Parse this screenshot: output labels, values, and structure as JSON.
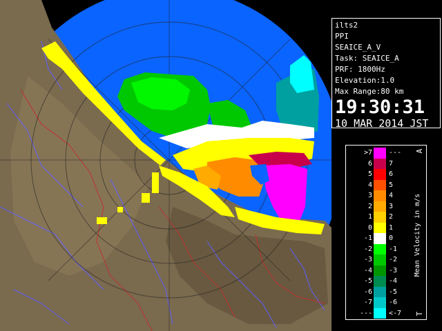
{
  "info": {
    "station": "ilts2",
    "mode": "PPI",
    "product": "SEAICE_A_V",
    "task": "Task: SEAICE_A",
    "prf": "PRF: 1800Hz",
    "elevation": "Elevation:1.0",
    "max_range": "Max Range:80 km",
    "time": "19:30:31",
    "date": "10 MAR 2014 JST"
  },
  "legend": {
    "title": "Mean Velocity in m/s",
    "top_letter": "A",
    "bottom_letter": "T",
    "rows": [
      {
        "left": ">7",
        "right": "---",
        "color": "#ff00ff"
      },
      {
        "left": "6",
        "right": "7",
        "color": "#c8004b"
      },
      {
        "left": "5",
        "right": "6",
        "color": "#ff0000"
      },
      {
        "left": "4",
        "right": "5",
        "color": "#ff5000"
      },
      {
        "left": "3",
        "right": "4",
        "color": "#ff8c00"
      },
      {
        "left": "2",
        "right": "3",
        "color": "#ffaa00"
      },
      {
        "left": "1",
        "right": "2",
        "color": "#ffd000"
      },
      {
        "left": "0",
        "right": "1",
        "color": "#ffff00"
      },
      {
        "left": "-1",
        "right": "0",
        "color": "#ffffff"
      },
      {
        "left": "-2",
        "right": "-1",
        "color": "#00ff00"
      },
      {
        "left": "-3",
        "right": "-2",
        "color": "#00c800"
      },
      {
        "left": "-4",
        "right": "-3",
        "color": "#009600"
      },
      {
        "left": "-5",
        "right": "-4",
        "color": "#008c50"
      },
      {
        "left": "-6",
        "right": "-5",
        "color": "#00a0a0"
      },
      {
        "left": "-7",
        "right": "-6",
        "color": "#00c8c8"
      },
      {
        "left": "---",
        "right": "<-7",
        "color": "#00ffff"
      }
    ]
  },
  "colors": {
    "sea": "#0a64ff",
    "land": "#7a6a4e",
    "river": "#6060ff",
    "border": "#c03030"
  }
}
